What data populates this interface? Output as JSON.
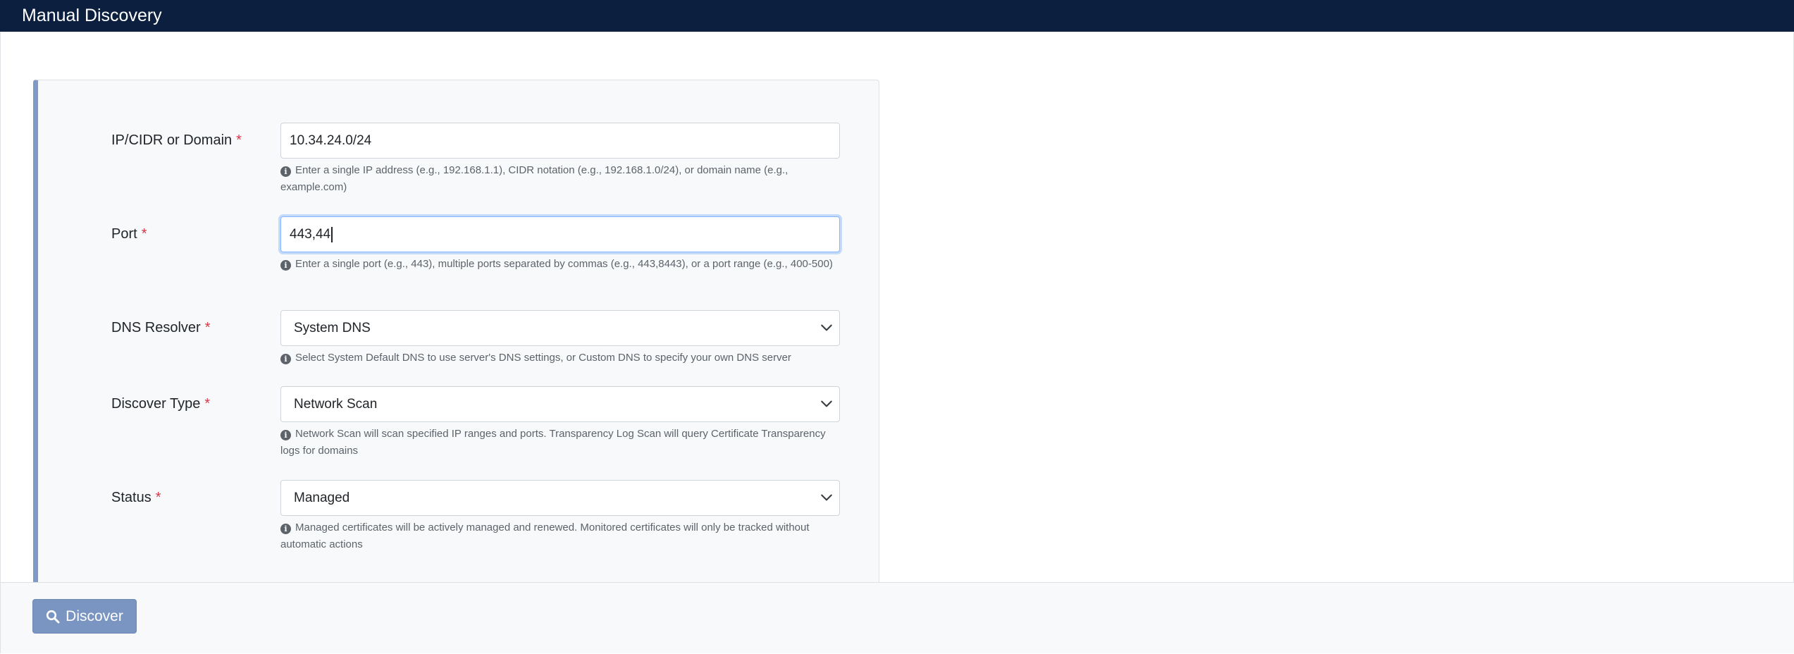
{
  "header": {
    "title": "Manual Discovery"
  },
  "form": {
    "ip": {
      "label": "IP/CIDR or Domain",
      "required_mark": "*",
      "value": "10.34.24.0/24",
      "help": "Enter a single IP address (e.g., 192.168.1.1), CIDR notation (e.g., 192.168.1.0/24), or domain name (e.g., example.com)"
    },
    "port": {
      "label": "Port",
      "required_mark": "*",
      "value": "443,44",
      "help": "Enter a single port (e.g., 443), multiple ports separated by commas (e.g., 443,8443), or a port range (e.g., 400-500)"
    },
    "dns": {
      "label": "DNS Resolver",
      "required_mark": "*",
      "selected": "System DNS",
      "help": "Select System Default DNS to use server's DNS settings, or Custom DNS to specify your own DNS server"
    },
    "discover_type": {
      "label": "Discover Type",
      "required_mark": "*",
      "selected": "Network Scan",
      "help": "Network Scan will scan specified IP ranges and ports. Transparency Log Scan will query Certificate Transparency logs for domains"
    },
    "status": {
      "label": "Status",
      "required_mark": "*",
      "selected": "Managed",
      "help": "Managed certificates will be actively managed and renewed. Monitored certificates will only be tracked without automatic actions"
    }
  },
  "footer": {
    "discover_label": "Discover"
  },
  "colors": {
    "header_bg": "#0c1f3f",
    "panel_accent": "#7f9ac7",
    "button_bg": "#7a95c1",
    "required": "#dc3545"
  },
  "icons": {
    "info": "info-circle-icon",
    "chevron": "chevron-down-icon",
    "search": "search-icon"
  }
}
